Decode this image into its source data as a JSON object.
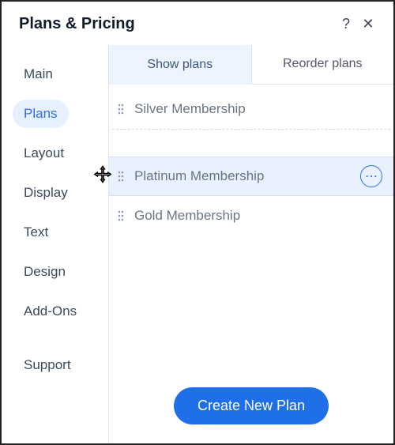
{
  "header": {
    "title": "Plans & Pricing"
  },
  "sidebar": {
    "items": [
      {
        "label": "Main",
        "active": false
      },
      {
        "label": "Plans",
        "active": true
      },
      {
        "label": "Layout",
        "active": false
      },
      {
        "label": "Display",
        "active": false
      },
      {
        "label": "Text",
        "active": false
      },
      {
        "label": "Design",
        "active": false
      },
      {
        "label": "Add-Ons",
        "active": false
      },
      {
        "label": "Support",
        "active": false
      }
    ]
  },
  "tabs": {
    "show": "Show plans",
    "reorder": "Reorder plans",
    "active": "show"
  },
  "plans": [
    {
      "label": "Silver Membership",
      "selected": false
    },
    {
      "label": "Platinum Membership",
      "selected": true
    },
    {
      "label": "Gold Membership",
      "selected": false
    }
  ],
  "cta": {
    "label": "Create New Plan"
  },
  "icons": {
    "help": "?",
    "close": "✕",
    "more": "⋯"
  }
}
